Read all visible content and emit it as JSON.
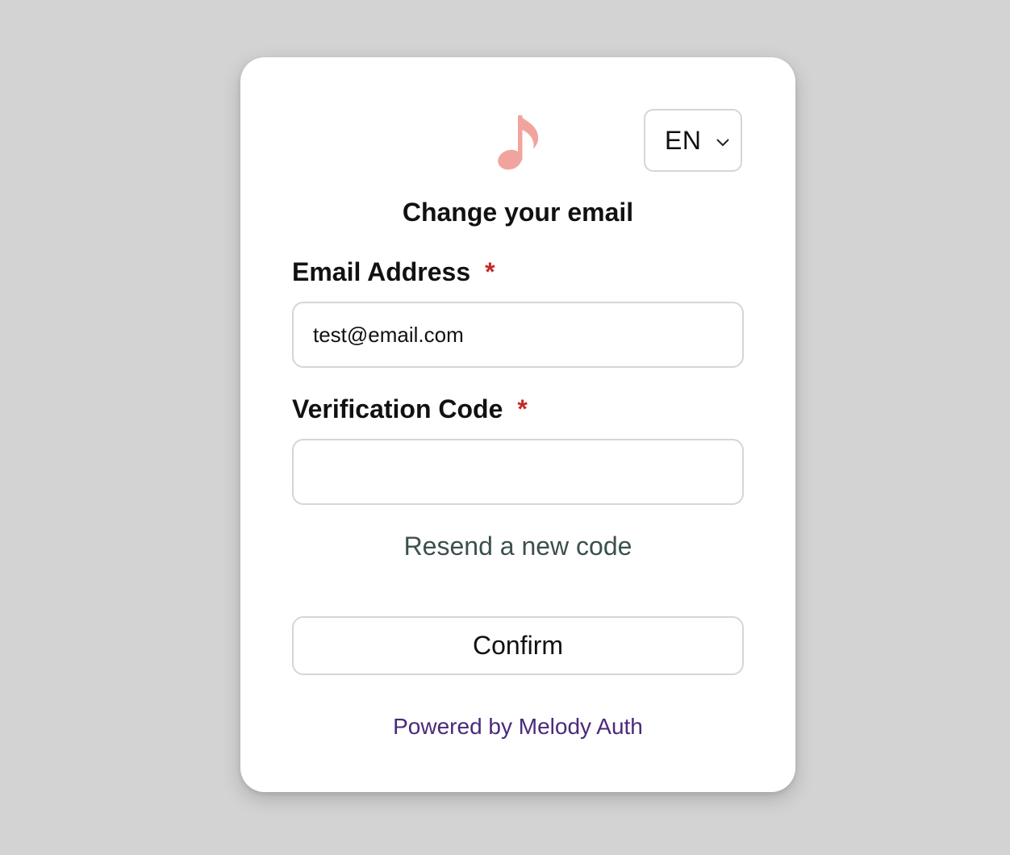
{
  "page": {
    "background_color": "#d3d3d3"
  },
  "header": {
    "logo_icon": "music-note-icon",
    "logo_color": "#f1a49d",
    "language": {
      "selected": "EN",
      "chevron_icon": "chevron-down-icon"
    }
  },
  "form": {
    "title": "Change your email",
    "email": {
      "label": "Email Address",
      "required_mark": "*",
      "value": "test@email.com",
      "placeholder": ""
    },
    "code": {
      "label": "Verification Code",
      "required_mark": "*",
      "value": "",
      "placeholder": ""
    },
    "resend_label": "Resend a new code",
    "confirm_label": "Confirm"
  },
  "footer": {
    "powered_by": "Powered by Melody Auth"
  },
  "colors": {
    "required": "#c62828",
    "resend_link": "#3b504f",
    "footer_link": "#4a2a7a",
    "border": "#d6d6d6"
  }
}
